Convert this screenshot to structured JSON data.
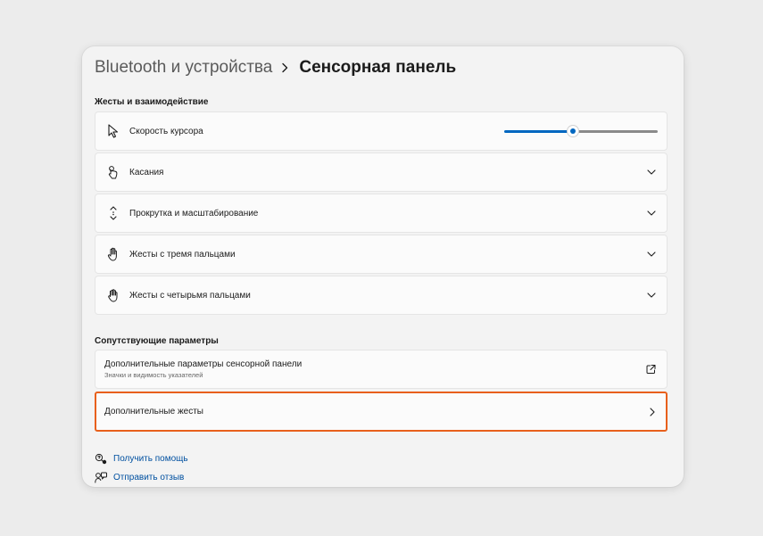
{
  "breadcrumb": {
    "parent": "Bluetooth и устройства",
    "current": "Сенсорная панель"
  },
  "sections": {
    "gestures_title": "Жесты и взаимодействие",
    "related_title": "Сопутствующие параметры"
  },
  "settings": [
    {
      "label": "Скорость курсора",
      "icon": "pointer-icon",
      "control": "slider"
    },
    {
      "label": "Касания",
      "icon": "tap-hand-icon",
      "control": "chevron-down"
    },
    {
      "label": "Прокрутка и масштабирование",
      "icon": "scroll-arrows-icon",
      "control": "chevron-down"
    },
    {
      "label": "Жесты с тремя пальцами",
      "icon": "three-finger-hand-icon",
      "control": "chevron-down"
    },
    {
      "label": "Жесты с четырьмя пальцами",
      "icon": "four-finger-hand-icon",
      "control": "chevron-down"
    }
  ],
  "cursor_speed": {
    "value": 0.45
  },
  "related": [
    {
      "label": "Дополнительные параметры сенсорной панели",
      "sub": "Значки и видимость указателей",
      "icon": "open-external-icon"
    },
    {
      "label": "Дополнительные жесты",
      "icon": "chevron-right-icon",
      "highlighted": true
    }
  ],
  "links": [
    {
      "label": "Получить помощь",
      "icon": "help-icon"
    },
    {
      "label": "Отправить отзыв",
      "icon": "feedback-icon"
    }
  ],
  "colors": {
    "accent": "#0067c0",
    "highlight": "#e8601c",
    "link": "#0050a0"
  }
}
